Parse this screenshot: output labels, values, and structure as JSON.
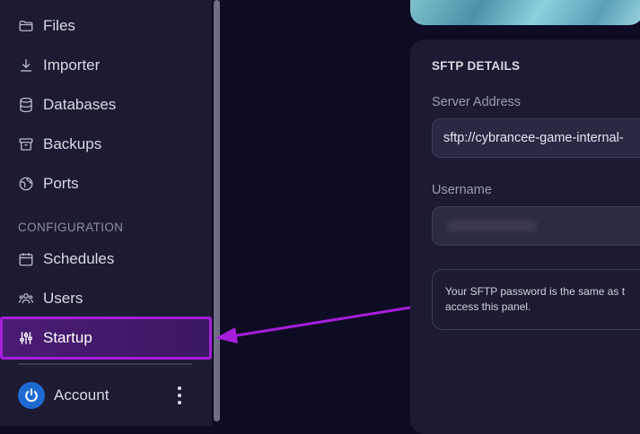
{
  "sidebar": {
    "items": [
      {
        "label": "Files",
        "icon": "folder-icon"
      },
      {
        "label": "Importer",
        "icon": "download-icon"
      },
      {
        "label": "Databases",
        "icon": "database-icon"
      },
      {
        "label": "Backups",
        "icon": "archive-icon"
      },
      {
        "label": "Ports",
        "icon": "globe-icon"
      }
    ],
    "section_title": "CONFIGURATION",
    "config_items": [
      {
        "label": "Schedules",
        "icon": "calendar-icon"
      },
      {
        "label": "Users",
        "icon": "users-icon"
      },
      {
        "label": "Startup",
        "icon": "sliders-icon",
        "active": true
      }
    ],
    "account_label": "Account"
  },
  "sftp": {
    "title": "SFTP DETAILS",
    "server_address_label": "Server Address",
    "server_address_value": "sftp://cybrancee-game-internal-",
    "username_label": "Username",
    "notice_line1": "Your SFTP password is the same as t",
    "notice_line2": "access this panel."
  },
  "colors": {
    "highlight_border": "#a61edb",
    "arrow": "#a61edb",
    "account_avatar": "#1d6bd2"
  }
}
